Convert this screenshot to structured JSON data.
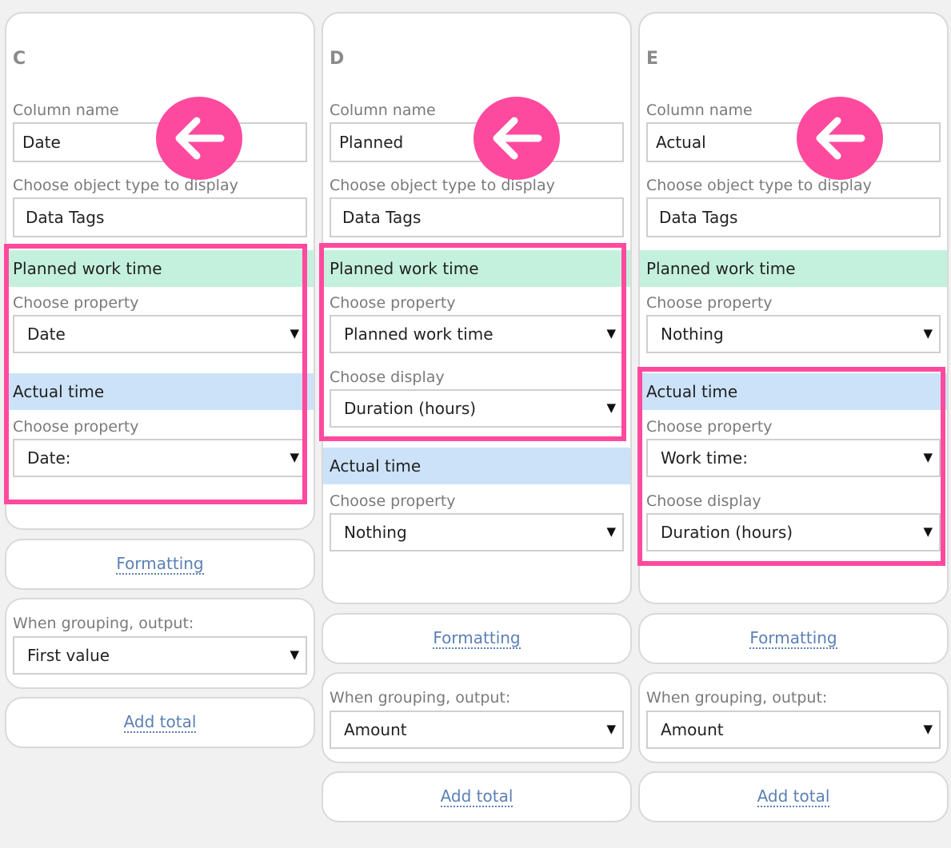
{
  "columns": [
    {
      "letter": "C",
      "column_name_label": "Column name",
      "column_name_value": "Date",
      "object_type_label": "Choose object type to display",
      "object_type_value": "Data Tags",
      "planned": {
        "title": "Planned work time",
        "property_label": "Choose property",
        "property_value": "Date"
      },
      "actual": {
        "title": "Actual time",
        "property_label": "Choose property",
        "property_value": "Date:"
      },
      "formatting": "Formatting",
      "grouping_label": "When grouping, output:",
      "grouping_value": "First value",
      "add_total": "Add total"
    },
    {
      "letter": "D",
      "column_name_label": "Column name",
      "column_name_value": "Planned",
      "object_type_label": "Choose object type to display",
      "object_type_value": "Data Tags",
      "planned": {
        "title": "Planned work time",
        "property_label": "Choose property",
        "property_value": "Planned work time",
        "display_label": "Choose display",
        "display_value": "Duration (hours)"
      },
      "actual": {
        "title": "Actual time",
        "property_label": "Choose property",
        "property_value": "Nothing"
      },
      "formatting": "Formatting",
      "grouping_label": "When grouping, output:",
      "grouping_value": "Amount",
      "add_total": "Add total"
    },
    {
      "letter": "E",
      "column_name_label": "Column name",
      "column_name_value": "Actual",
      "object_type_label": "Choose object type to display",
      "object_type_value": "Data Tags",
      "planned": {
        "title": "Planned work time",
        "property_label": "Choose property",
        "property_value": "Nothing"
      },
      "actual": {
        "title": "Actual time",
        "property_label": "Choose property",
        "property_value": "Work time:",
        "display_label": "Choose display",
        "display_value": "Duration (hours)"
      },
      "formatting": "Formatting",
      "grouping_label": "When grouping, output:",
      "grouping_value": "Amount",
      "add_total": "Add total"
    }
  ],
  "caret_glyph": "▼",
  "colors": {
    "highlight": "#fe4a9e",
    "planned_bg": "#c4f1dd",
    "actual_bg": "#cce2f8",
    "link": "#5b80b5"
  },
  "icons": {
    "annotation": "arrow-left-icon"
  }
}
